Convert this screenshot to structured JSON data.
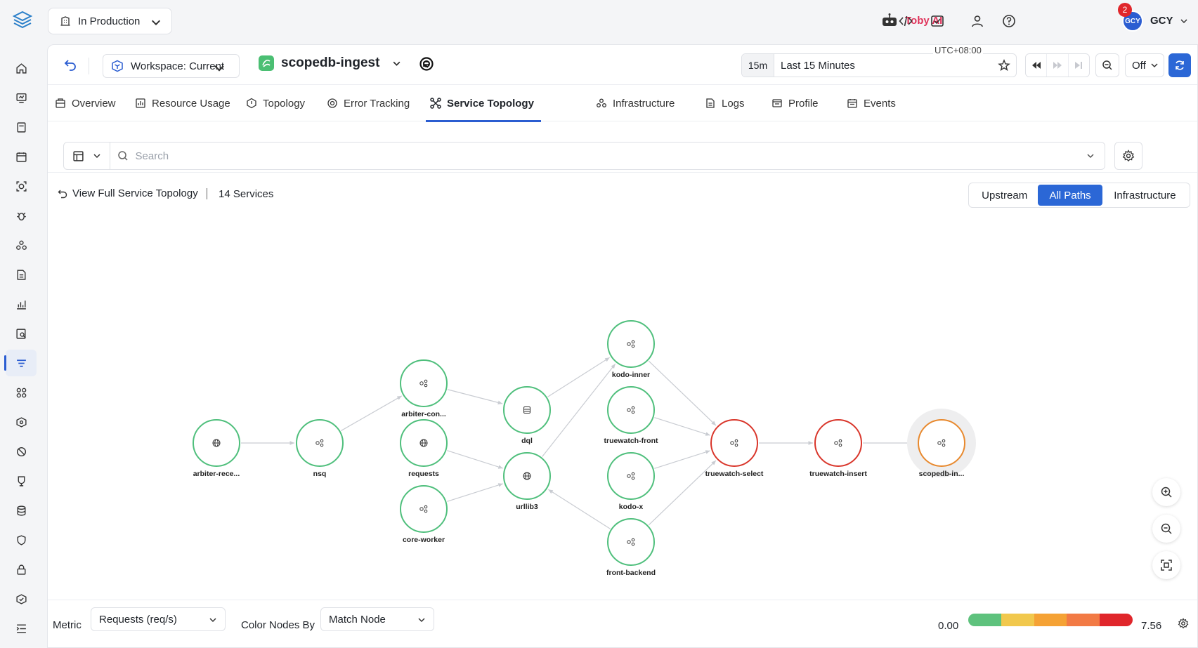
{
  "header": {
    "environment": "In Production",
    "assistant": "Toby AI",
    "notification_count": "2",
    "avatar_initials": "GCY",
    "user_name": "GCY"
  },
  "toolbar": {
    "workspace": "Workspace: Current",
    "service_name": "scopedb-ingest",
    "time_short": "15m",
    "time_label": "Last 15 Minutes",
    "timezone": "UTC+08:00",
    "refresh_mode": "Off"
  },
  "tabs": [
    {
      "label": "Overview",
      "icon": "overview-icon"
    },
    {
      "label": "Resource Usage",
      "icon": "resource-icon"
    },
    {
      "label": "Topology",
      "icon": "topology-icon"
    },
    {
      "label": "Error Tracking",
      "icon": "error-tracking-icon"
    },
    {
      "label": "Service Topology",
      "icon": "service-topology-icon",
      "active": true
    },
    {
      "label": "Infrastructure",
      "icon": "infrastructure-icon"
    },
    {
      "label": "Logs",
      "icon": "logs-icon"
    },
    {
      "label": "Profile",
      "icon": "profile-icon"
    },
    {
      "label": "Events",
      "icon": "events-icon"
    }
  ],
  "filter": {
    "search_placeholder": "Search"
  },
  "view": {
    "full_topology_label": "View Full Service Topology",
    "service_count": "14 Services",
    "modes": [
      "Upstream",
      "All Paths",
      "Infrastructure"
    ],
    "active_mode": "All Paths"
  },
  "topology": {
    "nodes": [
      {
        "id": "n1",
        "label": "arbiter-rece...",
        "status": "normal",
        "icon": "globe-icon"
      },
      {
        "id": "n2",
        "label": "nsq",
        "status": "normal",
        "icon": "service-icon"
      },
      {
        "id": "n3",
        "label": "arbiter-con...",
        "status": "normal",
        "icon": "service-icon"
      },
      {
        "id": "n4",
        "label": "requests",
        "status": "normal",
        "icon": "globe-icon"
      },
      {
        "id": "n5",
        "label": "core-worker",
        "status": "normal",
        "icon": "service-icon"
      },
      {
        "id": "n6",
        "label": "dql",
        "status": "normal",
        "icon": "database-icon"
      },
      {
        "id": "n7",
        "label": "urllib3",
        "status": "normal",
        "icon": "globe-icon"
      },
      {
        "id": "n8",
        "label": "kodo-inner",
        "status": "normal",
        "icon": "service-icon"
      },
      {
        "id": "n9",
        "label": "truewatch-front",
        "status": "normal",
        "icon": "service-icon"
      },
      {
        "id": "n10",
        "label": "kodo-x",
        "status": "normal",
        "icon": "service-icon"
      },
      {
        "id": "n11",
        "label": "front-backend",
        "status": "normal",
        "icon": "service-icon"
      },
      {
        "id": "n12",
        "label": "truewatch-select",
        "status": "error",
        "icon": "service-icon"
      },
      {
        "id": "n13",
        "label": "truewatch-insert",
        "status": "error",
        "icon": "service-icon"
      },
      {
        "id": "n14",
        "label": "scopedb-in...",
        "status": "current",
        "icon": "service-icon"
      }
    ],
    "edges": [
      [
        "n1",
        "n2"
      ],
      [
        "n2",
        "n3"
      ],
      [
        "n3",
        "n6"
      ],
      [
        "n4",
        "n7"
      ],
      [
        "n5",
        "n7"
      ],
      [
        "n6",
        "n8"
      ],
      [
        "n7",
        "n8"
      ],
      [
        "n11",
        "n7"
      ],
      [
        "n8",
        "n12"
      ],
      [
        "n9",
        "n12"
      ],
      [
        "n10",
        "n12"
      ],
      [
        "n11",
        "n12"
      ],
      [
        "n12",
        "n13"
      ],
      [
        "n13",
        "n14"
      ]
    ],
    "colors": {
      "normal": "#4fbf7c",
      "error": "#d9362b",
      "current": "#e8892e",
      "edge": "#c9ccd2"
    }
  },
  "bottom": {
    "metric_label": "Metric",
    "metric_value": "Requests (req/s)",
    "color_by_label": "Color Nodes By",
    "color_by_value": "Match Node",
    "scale_min": "0.00",
    "scale_max": "7.56",
    "scale_colors": [
      "#5ec27d",
      "#f1c84d",
      "#f5a235",
      "#f27a45",
      "#e0262b"
    ]
  }
}
